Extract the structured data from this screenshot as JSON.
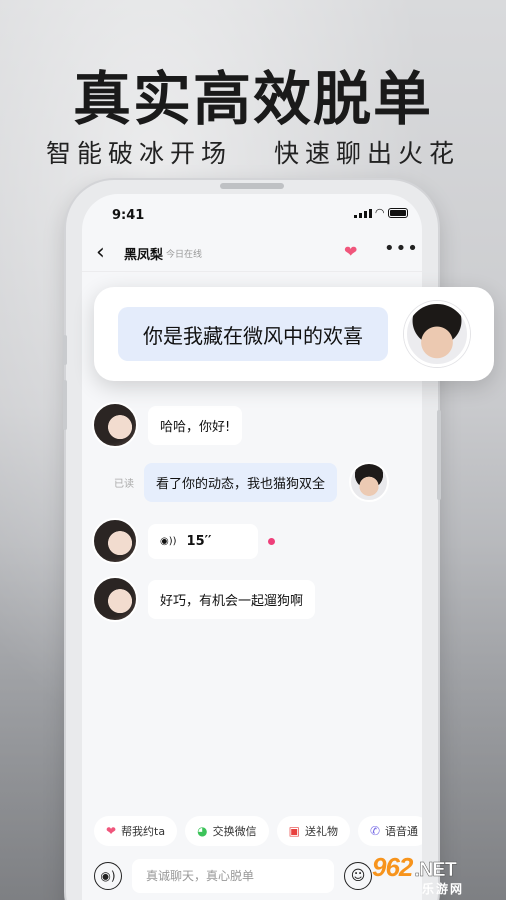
{
  "hero": {
    "title": "真实高效脱单",
    "subtitle_left": "智能破冰开场",
    "subtitle_right": "快速聊出火花"
  },
  "status_bar": {
    "time": "9:41"
  },
  "chat_header": {
    "back_icon": "‹",
    "contact_name": "黑凤梨",
    "online_status": "今日在线",
    "heart_icon": "❤",
    "more_icon": "•••"
  },
  "featured_message": {
    "text": "你是我藏在微风中的欢喜"
  },
  "messages": [
    {
      "side": "left",
      "text": "哈哈，你好!"
    },
    {
      "side": "right",
      "read": "已读",
      "text": "看了你的动态，我也猫狗双全"
    },
    {
      "side": "left",
      "voice_icon": "◉))",
      "duration": "15′′"
    },
    {
      "side": "left",
      "text": "好巧，有机会一起遛狗啊"
    }
  ],
  "quick_actions": [
    {
      "icon": "❤",
      "icon_color": "#f0567c",
      "label": "帮我约ta"
    },
    {
      "icon": "◕",
      "icon_color": "#3cc35a",
      "label": "交换微信"
    },
    {
      "icon": "▣",
      "icon_color": "#e8413f",
      "label": "送礼物"
    },
    {
      "icon": "✆",
      "icon_color": "#7a6ee6",
      "label": "语音通"
    }
  ],
  "input": {
    "placeholder": "真诚聊天，真心脱单",
    "voice_icon": "◉)",
    "emoji_icon": "☺"
  },
  "watermark": {
    "brand": "962",
    "net": ".NET",
    "sub": "乐游网"
  }
}
